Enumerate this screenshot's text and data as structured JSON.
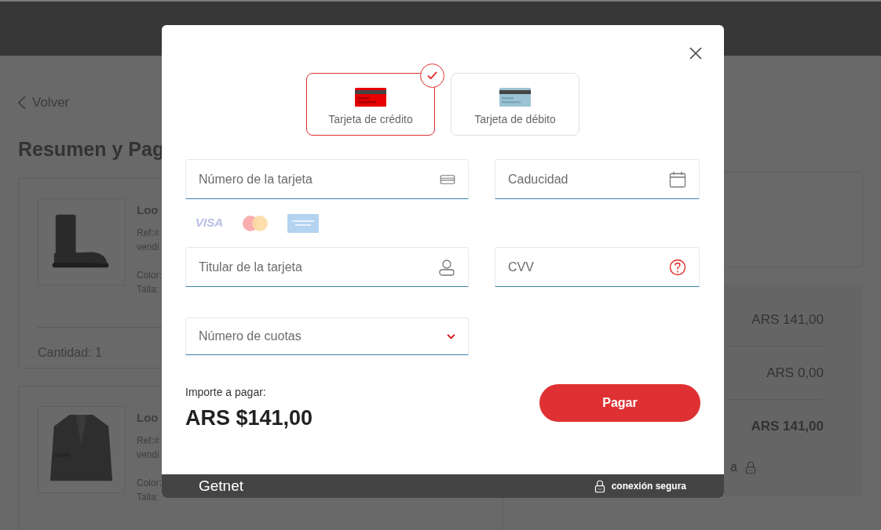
{
  "page": {
    "back_link": "Volver",
    "title": "Resumen y Pag",
    "products": [
      {
        "name": "Loo",
        "ref": "Ref:#",
        "seller": "vendi",
        "color_label": "Color:",
        "size_label": "Talla:",
        "quantity": "Cantidad: 1",
        "kind": "boot"
      },
      {
        "name": "Loo",
        "ref": "Ref:#",
        "seller": "vendi",
        "color_label": "Color:",
        "size_label": "Talla:",
        "kind": "jacket"
      }
    ],
    "summary": {
      "rows": [
        {
          "amount": "ARS 141,00",
          "bold": false
        },
        {
          "amount": "ARS 0,00",
          "bold": false
        },
        {
          "amount": "ARS 141,00",
          "bold": true
        }
      ],
      "secure_text": "a"
    }
  },
  "modal": {
    "card_types": [
      {
        "label": "Tarjeta de crédito",
        "kind": "credit",
        "selected": true
      },
      {
        "label": "Tarjeta de débito",
        "kind": "debit",
        "selected": false
      }
    ],
    "fields": [
      {
        "placeholder": "Número de la tarjeta",
        "kind": "card"
      },
      {
        "placeholder": "Caducidad",
        "kind": "date"
      },
      {
        "placeholder": "Titular de la tarjeta",
        "kind": "person"
      },
      {
        "placeholder": "CVV",
        "kind": "help"
      }
    ],
    "brand_logo": "VISA",
    "installments": {
      "placeholder": "Número de cuotas"
    },
    "amount_label": "Importe a pagar:",
    "amount": "ARS $141,00",
    "pay_button": "Pagar",
    "footer": {
      "brand": "Getnet",
      "secure": "conexión segura"
    }
  }
}
